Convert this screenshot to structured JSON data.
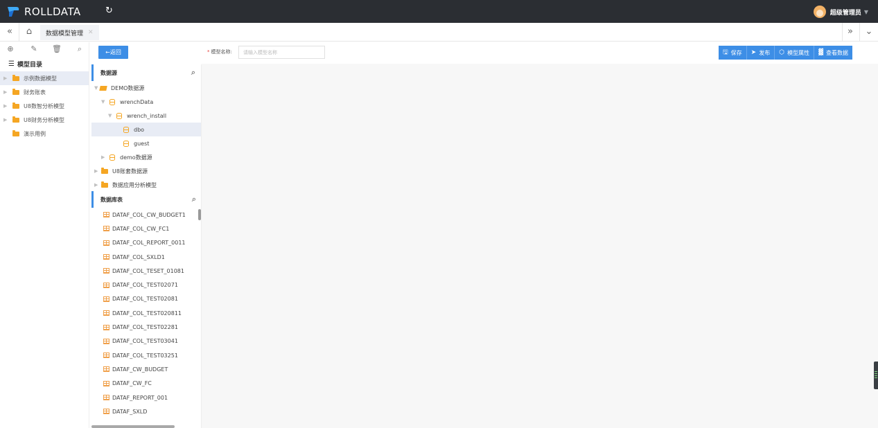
{
  "app": {
    "brand": "ROLLDATA",
    "user": "超级管理员"
  },
  "tabs": {
    "active": "数据模型管理"
  },
  "sidebar": {
    "title": "模型目录",
    "items": [
      {
        "label": "示例数据模型",
        "selected": true,
        "expandable": true
      },
      {
        "label": "财务账表",
        "expandable": true
      },
      {
        "label": "U8数智分析模型",
        "expandable": true
      },
      {
        "label": "U8财务分析模型",
        "expandable": true
      },
      {
        "label": "演示用例",
        "expandable": false
      }
    ]
  },
  "toolbar": {
    "back_label": "返回",
    "name_label": "模型名称:",
    "name_placeholder": "请输入模型名称",
    "save_label": "保存",
    "publish_label": "发布",
    "props_label": "模型属性",
    "view_label": "查看数据"
  },
  "datasource": {
    "title": "数据源",
    "tree": [
      {
        "label": "DEMO数据源",
        "level": 0
      },
      {
        "label": "wrenchData",
        "level": 1
      },
      {
        "label": "wrench_install",
        "level": 2
      },
      {
        "label": "dbo",
        "level": 3,
        "selected": true
      },
      {
        "label": "guest",
        "level": 3
      },
      {
        "label": "demo数据源",
        "level": 1
      },
      {
        "label": "U8账套数据源",
        "level": 0
      },
      {
        "label": "数据应用分析模型",
        "level": 0
      }
    ]
  },
  "tables": {
    "title": "数据库表",
    "items": [
      "DATAF_COL_CW_BUDGET1",
      "DATAF_COL_CW_FC1",
      "DATAF_COL_REPORT_0011",
      "DATAF_COL_SXLD1",
      "DATAF_COL_TESET_01081",
      "DATAF_COL_TEST02071",
      "DATAF_COL_TEST02081",
      "DATAF_COL_TEST020811",
      "DATAF_COL_TEST02281",
      "DATAF_COL_TEST03041",
      "DATAF_COL_TEST03251",
      "DATAF_CW_BUDGET",
      "DATAF_CW_FC",
      "DATAF_REPORT_001",
      "DATAF_SXLD"
    ]
  },
  "colors": {
    "topbar": "#2b2e33",
    "accent": "#3d8ee6",
    "folder": "#f5a623"
  }
}
